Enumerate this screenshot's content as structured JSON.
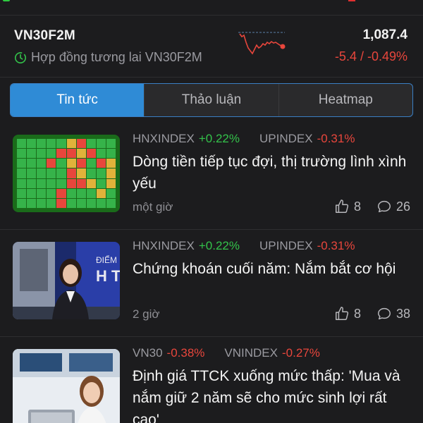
{
  "ticker": {
    "symbol": "VN30F2M",
    "subtitle": "Hợp đồng tương lai VN30F2M",
    "price": "1,087.4",
    "change": "-5.4 / -0.49%",
    "colors": {
      "down": "#e8463c",
      "up": "#33c24a",
      "accent": "#2f8bd6"
    }
  },
  "tabs": [
    {
      "label": "Tin tức",
      "active": true
    },
    {
      "label": "Thảo luận",
      "active": false
    },
    {
      "label": "Heatmap",
      "active": false
    }
  ],
  "news": [
    {
      "tags": [
        {
          "name": "HNXINDEX",
          "value": "+0.22%",
          "dir": "up"
        },
        {
          "name": "UPINDEX",
          "value": "-0.31%",
          "dir": "down"
        }
      ],
      "title": "Dòng tiền tiếp tục đợi, thị trường lình xình yếu",
      "time": "một giờ",
      "likes": "8",
      "comments": "26",
      "thumb": "heatmap-thumbnail"
    },
    {
      "tags": [
        {
          "name": "HNXINDEX",
          "value": "+0.22%",
          "dir": "up"
        },
        {
          "name": "UPINDEX",
          "value": "-0.31%",
          "dir": "down"
        }
      ],
      "title": "Chứng khoán cuối năm: Nắm bắt cơ hội",
      "time": "2 giờ",
      "likes": "8",
      "comments": "38",
      "thumb": "presenter-thumbnail"
    },
    {
      "tags": [
        {
          "name": "VN30",
          "value": "-0.38%",
          "dir": "down"
        },
        {
          "name": "VNINDEX",
          "value": "-0.27%",
          "dir": "down"
        }
      ],
      "title": "Định giá TTCK xuống mức thấp: 'Mua và nắm giữ 2 năm sẽ cho mức sinh lợi rất cao'",
      "time": "",
      "likes": "",
      "comments": "",
      "thumb": "analyst-thumbnail"
    }
  ]
}
